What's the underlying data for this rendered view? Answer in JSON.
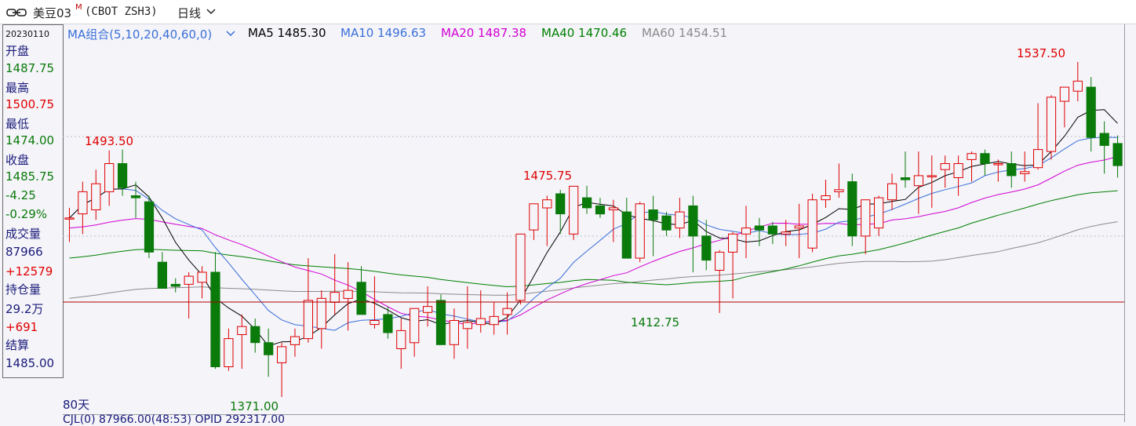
{
  "header": {
    "name": "美豆03",
    "superscript": "M",
    "code": "(CBOT ZSH3)",
    "period": "日线"
  },
  "info_panel": {
    "date": "20230110",
    "open_label": "开盘",
    "open_value": "1487.75",
    "high_label": "最高",
    "high_value": "1500.75",
    "low_label": "最低",
    "low_value": "1474.00",
    "close_label": "收盘",
    "close_value": "1485.75",
    "change": "-4.25",
    "change_pct": "-0.29%",
    "volume_label": "成交量",
    "volume_value": "87966",
    "volume_change": "+12579",
    "oi_label": "持仓量",
    "oi_value": "29.2万",
    "oi_change": "+691",
    "settle_label": "结算",
    "settle_value": "1485.00"
  },
  "legend": {
    "group": "MA组合(5,10,20,40,60,0)",
    "ma5": "MA5 1485.30",
    "ma10": "MA10 1496.63",
    "ma20": "MA20 1487.38",
    "ma40": "MA40 1470.46",
    "ma60": "MA60 1454.51"
  },
  "colors": {
    "up": "#e00000",
    "down": "#0a7a0a",
    "ma5": "#000000",
    "ma10": "#3b6fd8",
    "ma20": "#d400d4",
    "ma40": "#008000",
    "ma60": "#8c8c8c",
    "crosshair": "#b00000"
  },
  "annotations": {
    "high1": "1493.50",
    "high2": "1475.75",
    "high3": "1537.50",
    "low1": "1371.00",
    "low2": "1412.75"
  },
  "days_label": "80天",
  "bottom_text": "CJL(0)      87966.00(48:53)  OPID 292317.00",
  "chart_data": {
    "type": "candlestick",
    "candles": [
      [
        1460.0,
        1465.0,
        1448.0,
        1460.0
      ],
      [
        1462.0,
        1478.0,
        1452.0,
        1473.0
      ],
      [
        1464.0,
        1484.0,
        1459.0,
        1477.0
      ],
      [
        1473.0,
        1493.5,
        1466.0,
        1487.0
      ],
      [
        1487.0,
        1494.0,
        1471.0,
        1475.0
      ],
      [
        1471.0,
        1478.0,
        1460.0,
        1470.0
      ],
      [
        1468.0,
        1471.0,
        1440.0,
        1443.0
      ],
      [
        1438.0,
        1443.0,
        1425.0,
        1425.0
      ],
      [
        1427.0,
        1430.0,
        1423.0,
        1426.0
      ],
      [
        1427.0,
        1433.0,
        1410.0,
        1431.0
      ],
      [
        1428.0,
        1436.0,
        1420.0,
        1433.0
      ],
      [
        1433.0,
        1443.0,
        1385.0,
        1386.0
      ],
      [
        1386.0,
        1405.0,
        1384.0,
        1400.0
      ],
      [
        1402.0,
        1412.0,
        1385.0,
        1406.0
      ],
      [
        1406.0,
        1410.0,
        1393.0,
        1398.0
      ],
      [
        1398.0,
        1405.0,
        1381.0,
        1392.0
      ],
      [
        1388.0,
        1398.0,
        1371.0,
        1396.0
      ],
      [
        1397.0,
        1405.0,
        1391.0,
        1401.0
      ],
      [
        1400.0,
        1440.0,
        1398.0,
        1419.0
      ],
      [
        1405.0,
        1424.0,
        1395.0,
        1420.0
      ],
      [
        1418.0,
        1442.0,
        1412.0,
        1423.0
      ],
      [
        1420.0,
        1438.0,
        1404.0,
        1424.0
      ],
      [
        1428.0,
        1436.0,
        1412.0,
        1412.0
      ],
      [
        1407.0,
        1431.0,
        1405.0,
        1409.0
      ],
      [
        1412.0,
        1416.0,
        1400.0,
        1403.0
      ],
      [
        1395.0,
        1410.0,
        1385.0,
        1404.0
      ],
      [
        1398.0,
        1413.0,
        1391.0,
        1415.0
      ],
      [
        1413.0,
        1426.0,
        1406.0,
        1416.0
      ],
      [
        1419.0,
        1422.0,
        1397.0,
        1397.0
      ],
      [
        1397.0,
        1415.0,
        1390.0,
        1409.0
      ],
      [
        1405.0,
        1426.0,
        1395.0,
        1408.0
      ],
      [
        1407.0,
        1424.0,
        1403.0,
        1410.0
      ],
      [
        1407.0,
        1418.0,
        1402.0,
        1411.0
      ],
      [
        1412.0,
        1423.0,
        1402.0,
        1415.0
      ],
      [
        1419.0,
        1450.0,
        1417.0,
        1452.0
      ],
      [
        1454.0,
        1466.0,
        1449.0,
        1467.0
      ],
      [
        1465.0,
        1471.0,
        1446.0,
        1469.0
      ],
      [
        1472.0,
        1474.0,
        1452.0,
        1462.0
      ],
      [
        1452.0,
        1474.0,
        1449.0,
        1475.75
      ],
      [
        1470.0,
        1476.0,
        1462.0,
        1465.0
      ],
      [
        1466.0,
        1470.0,
        1460.0,
        1462.0
      ],
      [
        1464.0,
        1469.0,
        1448.0,
        1465.0
      ],
      [
        1463.0,
        1470.0,
        1448.0,
        1440.0
      ],
      [
        1440.0,
        1468.0,
        1438.0,
        1467.0
      ],
      [
        1464.0,
        1471.0,
        1441.0,
        1459.0
      ],
      [
        1461.0,
        1463.0,
        1451.0,
        1454.0
      ],
      [
        1455.0,
        1470.0,
        1450.0,
        1463.0
      ],
      [
        1466.0,
        1471.0,
        1433.0,
        1451.0
      ],
      [
        1451.0,
        1459.0,
        1434.0,
        1439.0
      ],
      [
        1434.0,
        1444.0,
        1412.75,
        1443.0
      ],
      [
        1443.0,
        1453.0,
        1420.0,
        1452.0
      ],
      [
        1452.0,
        1466.0,
        1440.0,
        1455.0
      ],
      [
        1456.0,
        1460.0,
        1446.0,
        1454.0
      ],
      [
        1456.0,
        1458.0,
        1447.0,
        1452.0
      ],
      [
        1452.0,
        1459.0,
        1446.0,
        1453.0
      ],
      [
        1455.0,
        1467.0,
        1440.0,
        1456.0
      ],
      [
        1445.0,
        1472.0,
        1443.0,
        1469.0
      ],
      [
        1469.0,
        1479.0,
        1465.0,
        1471.0
      ],
      [
        1473.0,
        1487.0,
        1470.0,
        1474.0
      ],
      [
        1478.0,
        1482.0,
        1446.0,
        1451.0
      ],
      [
        1451.0,
        1468.0,
        1442.0,
        1469.0
      ],
      [
        1455.0,
        1471.0,
        1451.0,
        1470.0
      ],
      [
        1469.0,
        1482.0,
        1464.0,
        1477.0
      ],
      [
        1480.0,
        1493.0,
        1475.0,
        1479.0
      ],
      [
        1476.0,
        1493.0,
        1462.0,
        1481.0
      ],
      [
        1481.0,
        1491.0,
        1465.0,
        1481.0
      ],
      [
        1484.0,
        1491.0,
        1475.0,
        1487.0
      ],
      [
        1480.0,
        1491.0,
        1471.0,
        1487.0
      ],
      [
        1489.0,
        1493.0,
        1478.0,
        1492.0
      ],
      [
        1492.0,
        1494.0,
        1481.0,
        1487.0
      ],
      [
        1487.0,
        1489.0,
        1478.0,
        1487.0
      ],
      [
        1487.0,
        1493.0,
        1475.0,
        1481.0
      ],
      [
        1482.0,
        1493.0,
        1478.0,
        1483.0
      ],
      [
        1485.0,
        1517.0,
        1484.0,
        1494.0
      ],
      [
        1493.0,
        1521.0,
        1489.0,
        1520.0
      ],
      [
        1518.0,
        1525.0,
        1505.0,
        1525.0
      ],
      [
        1523.0,
        1537.5,
        1518.0,
        1528.0
      ],
      [
        1525.0,
        1530.0,
        1493.0,
        1500.0
      ],
      [
        1502.0,
        1508.0,
        1482.0,
        1496.0
      ],
      [
        1497.0,
        1501.0,
        1480.0,
        1486.0
      ]
    ],
    "ma_series": [
      "MA5",
      "MA10",
      "MA20",
      "MA40",
      "MA60"
    ],
    "labels": [
      "1493.50",
      "1475.75",
      "1537.50",
      "1371.00",
      "1412.75"
    ]
  }
}
